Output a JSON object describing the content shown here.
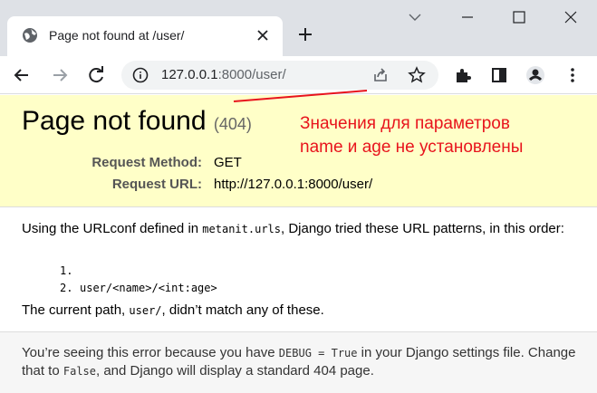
{
  "browser": {
    "tab_title": "Page not found at /user/",
    "url_host": "127.0.0.1",
    "url_rest": ":8000/user/"
  },
  "page": {
    "heading": "Page not found",
    "status_code": "(404)",
    "request": [
      {
        "label": "Request Method:",
        "value": "GET"
      },
      {
        "label": "Request URL:",
        "value": "http://127.0.0.1:8000/user/"
      }
    ],
    "info": {
      "intro_before": "Using the URLconf defined in ",
      "urlconf": "metanit.urls",
      "intro_after": ", Django tried these URL patterns, in this order:",
      "patterns": [
        {
          "num": "1.",
          "pattern": ""
        },
        {
          "num": "2.",
          "pattern": "user/<name>/<int:age>"
        }
      ],
      "current_before": "The current path, ",
      "current_path": "user/",
      "current_after": ", didn’t match any of these."
    },
    "explanation": {
      "p1": "You’re seeing this error because you have ",
      "debug_setting": "DEBUG = True",
      "p2": " in your Django settings file. Change that to ",
      "false_value": "False",
      "p3": ", and Django will display a standard 404 page."
    }
  },
  "annotation": {
    "line1": "Значения для параметров",
    "line2": "name и age не установлены",
    "color": "#e8141d"
  }
}
